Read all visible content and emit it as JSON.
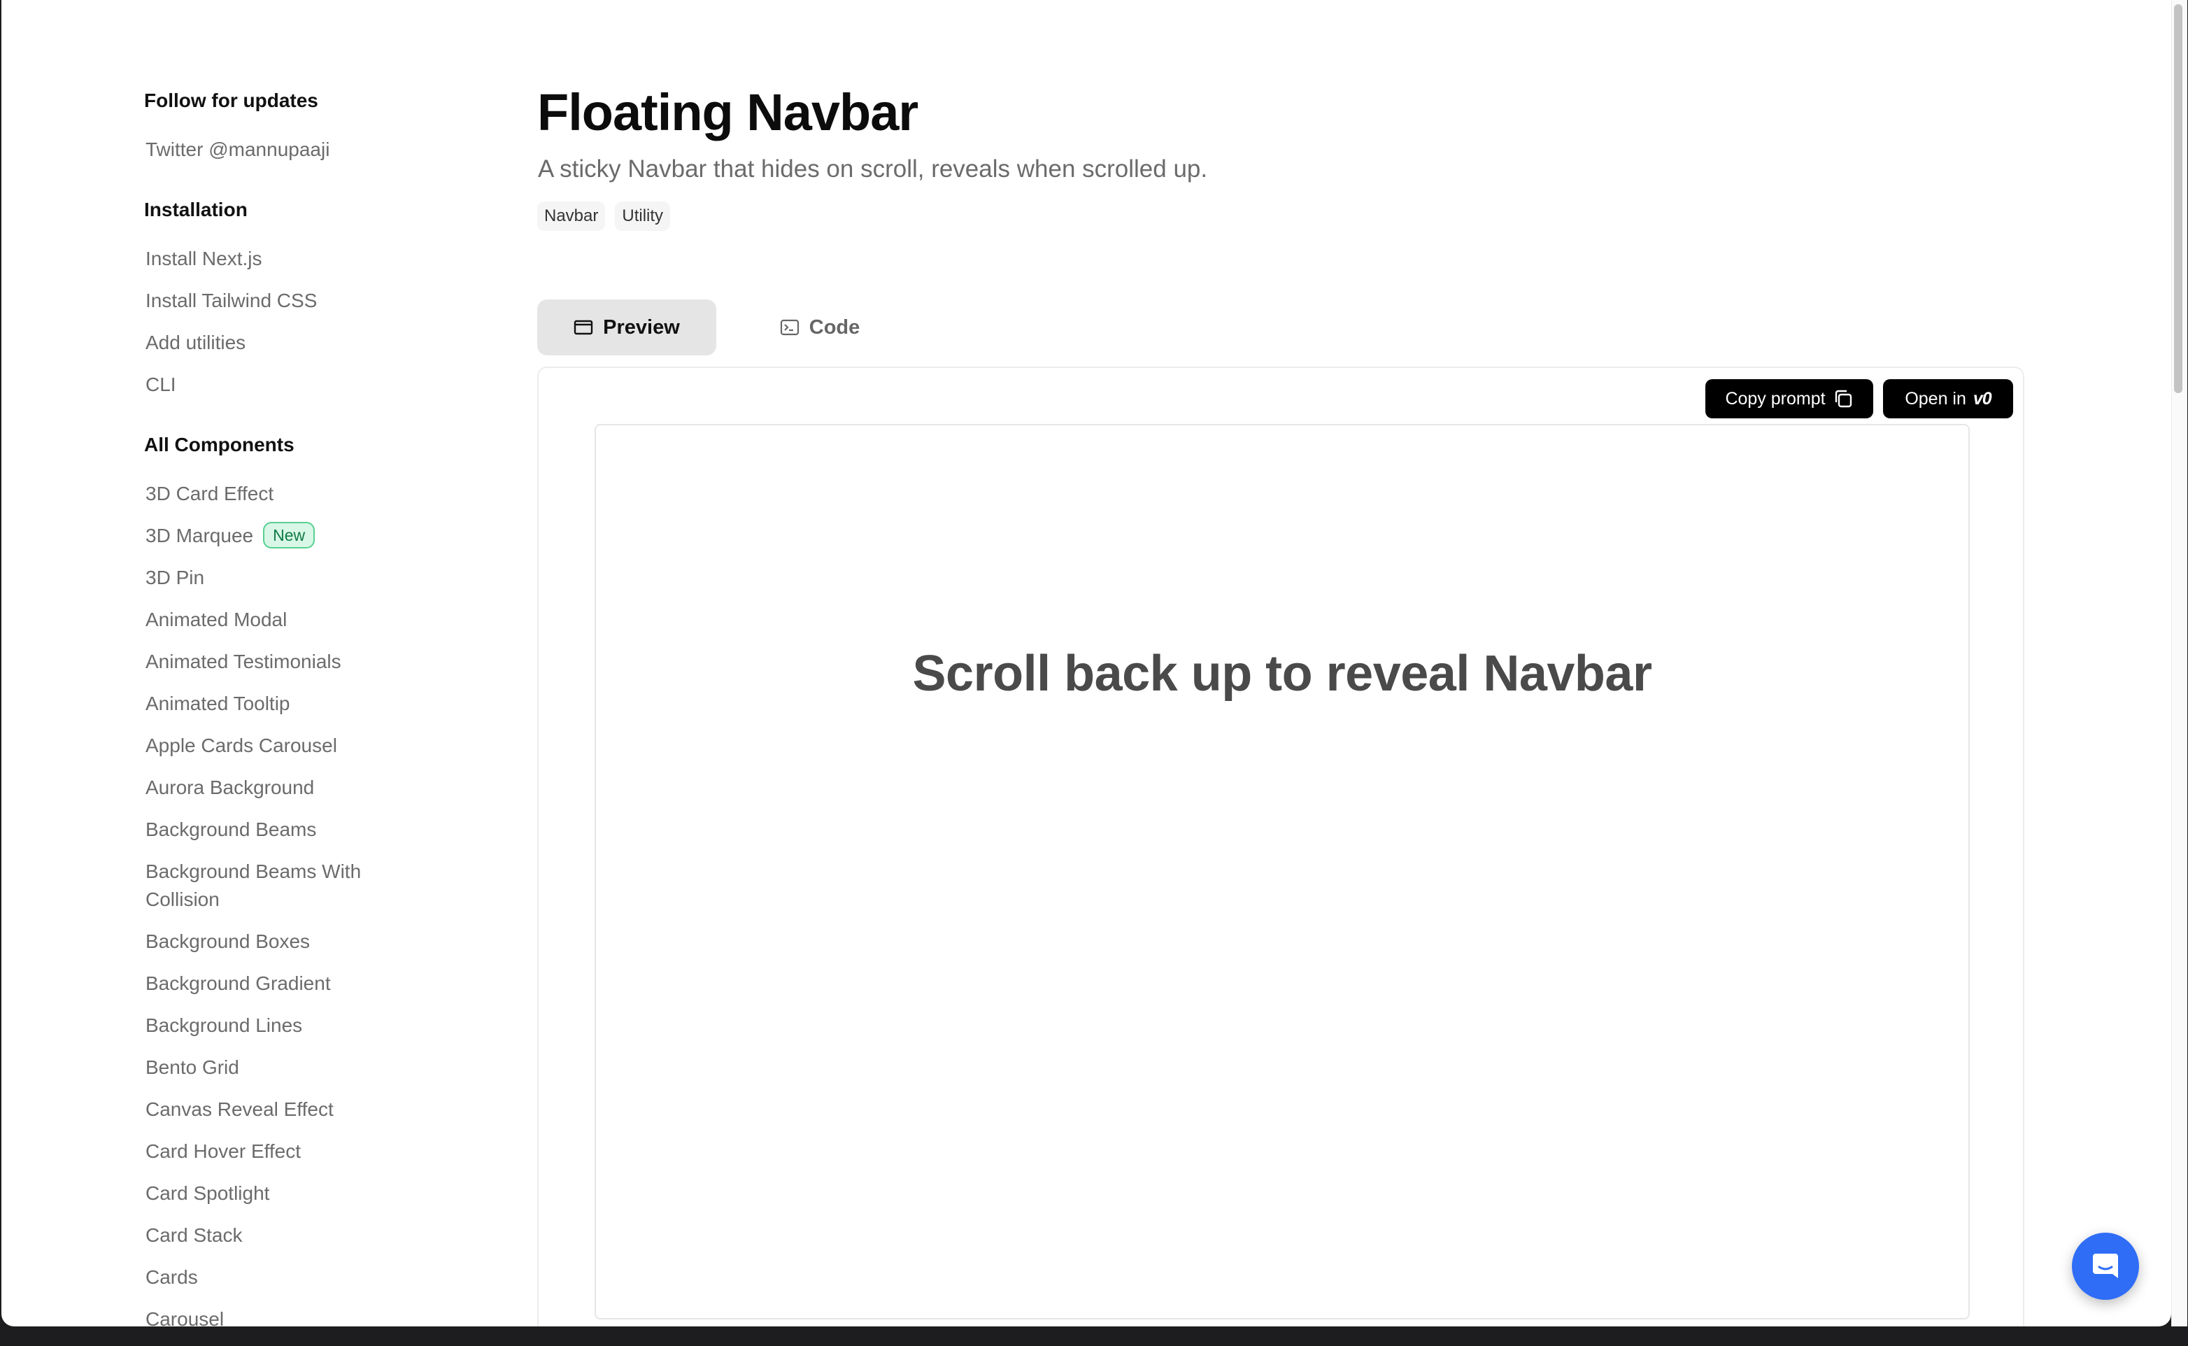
{
  "sidebar": {
    "follow": {
      "heading": "Follow for updates",
      "links": [
        "Twitter @mannupaaji"
      ]
    },
    "installation": {
      "heading": "Installation",
      "links": [
        "Install Next.js",
        "Install Tailwind CSS",
        "Add utilities",
        "CLI"
      ]
    },
    "components": {
      "heading": "All Components",
      "new_badge": "New",
      "links": [
        "3D Card Effect",
        "3D Marquee",
        "3D Pin",
        "Animated Modal",
        "Animated Testimonials",
        "Animated Tooltip",
        "Apple Cards Carousel",
        "Aurora Background",
        "Background Beams",
        "Background Beams With Collision",
        "Background Boxes",
        "Background Gradient",
        "Background Lines",
        "Bento Grid",
        "Canvas Reveal Effect",
        "Card Hover Effect",
        "Card Spotlight",
        "Card Stack",
        "Cards",
        "Carousel"
      ]
    }
  },
  "page": {
    "title": "Floating Navbar",
    "subtitle": "A sticky Navbar that hides on scroll, reveals when scrolled up.",
    "tags": [
      "Navbar",
      "Utility"
    ]
  },
  "tabs": {
    "preview": "Preview",
    "code": "Code",
    "active": "Preview"
  },
  "preview": {
    "copy_prompt": "Copy prompt",
    "open_in": "Open in",
    "open_in_brand": "v0",
    "message": "Scroll back up to reveal Navbar"
  },
  "icons": {
    "preview_tab": "window-icon",
    "code_tab": "terminal-icon",
    "copy": "copy-icon",
    "chat": "chat-bubble-icon"
  },
  "colors": {
    "accent": "#2f6df6",
    "new_badge_bg": "#d8f7e6",
    "new_badge_text": "#0f7a45"
  }
}
